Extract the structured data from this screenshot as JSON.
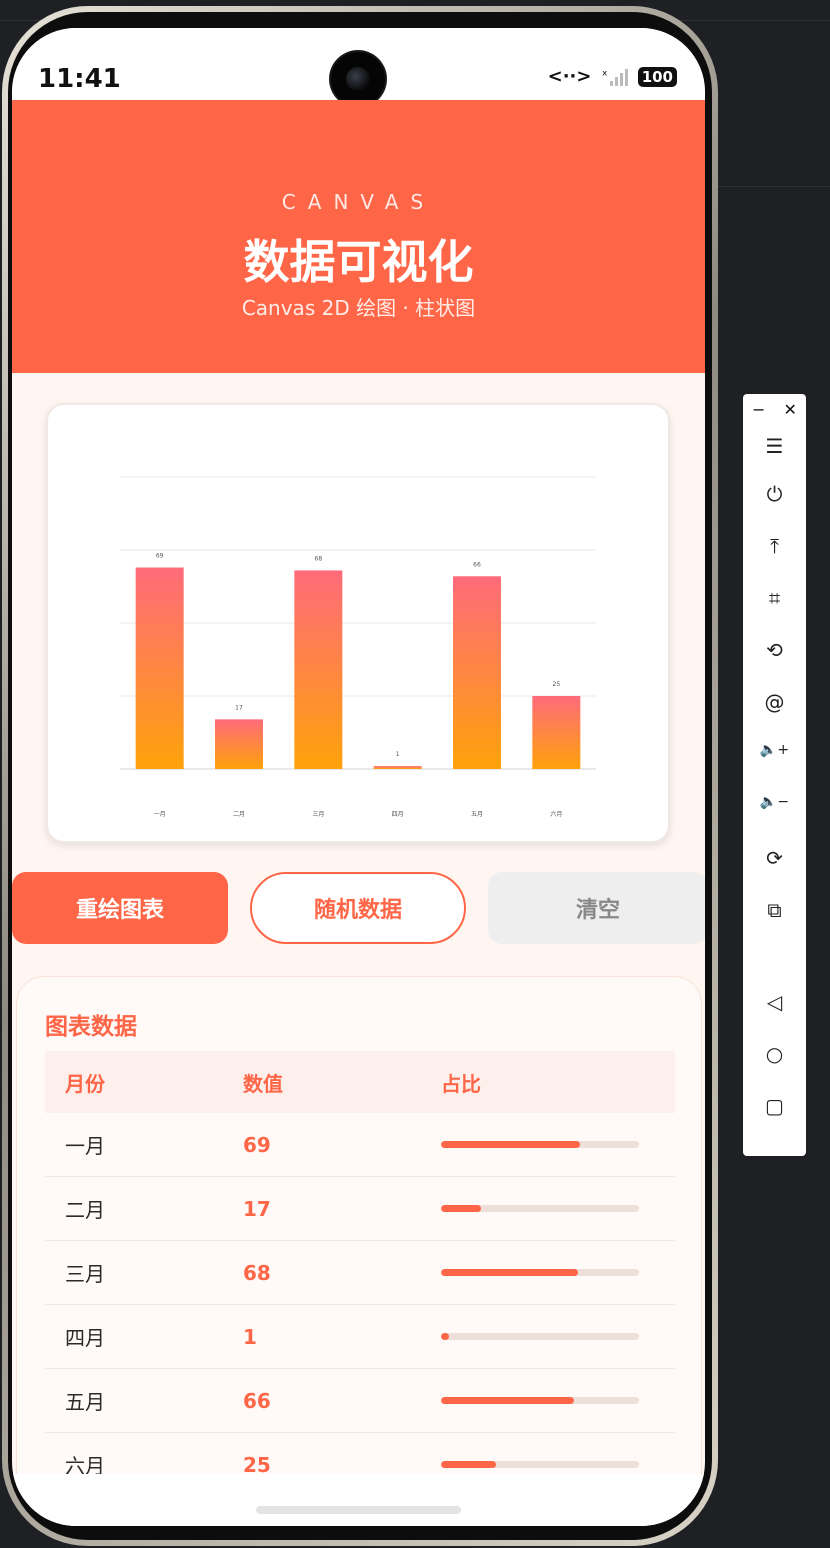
{
  "status_bar": {
    "time": "11:41",
    "signal": "<··>",
    "network": "ˣ",
    "battery": "100"
  },
  "header": {
    "eyebrow": "CANVAS",
    "title": "数据可视化",
    "subtitle": "Canvas 2D 绘图 · 柱状图"
  },
  "chart_data": {
    "type": "bar",
    "categories": [
      "一月",
      "二月",
      "三月",
      "四月",
      "五月",
      "六月"
    ],
    "values": [
      69,
      17,
      68,
      1,
      66,
      25
    ],
    "ylim": [
      0,
      100
    ],
    "grid": true,
    "colors": {
      "bar_top": "#ff6b7a",
      "bar_bottom": "#ffa20a"
    }
  },
  "buttons": {
    "redraw": "重绘图表",
    "random": "随机数据",
    "clear": "清空"
  },
  "table": {
    "title": "图表数据",
    "headers": [
      "月份",
      "数值",
      "占比"
    ],
    "rows": [
      {
        "month": "一月",
        "value": "69",
        "ratio": 0.7
      },
      {
        "month": "二月",
        "value": "17",
        "ratio": 0.2
      },
      {
        "month": "三月",
        "value": "68",
        "ratio": 0.69
      },
      {
        "month": "四月",
        "value": "1",
        "ratio": 0.04
      },
      {
        "month": "五月",
        "value": "66",
        "ratio": 0.67
      },
      {
        "month": "六月",
        "value": "25",
        "ratio": 0.28
      }
    ]
  },
  "toolbar": {
    "icons": [
      "menu-icon",
      "power-icon",
      "upload-icon",
      "crop-icon",
      "rotate-icon",
      "at-icon",
      "volume-up-icon",
      "volume-down-icon",
      "rotate-device-icon",
      "screenshot-icon",
      "back-icon",
      "home-icon",
      "recent-apps-icon"
    ]
  },
  "colors": {
    "accent": "#ff6647",
    "background": "#fff6f2"
  }
}
